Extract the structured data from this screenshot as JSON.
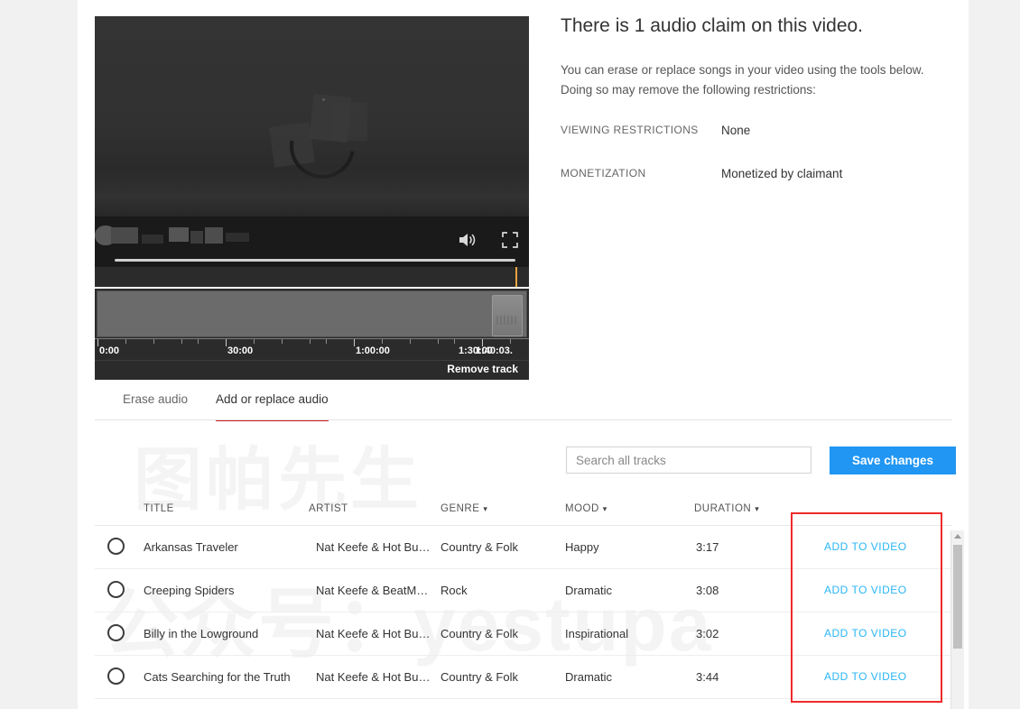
{
  "player": {
    "volume_icon": "volume-icon",
    "fullscreen_icon": "fullscreen-icon",
    "remove_track_label": "Remove track",
    "ruler_labels": [
      "0:00",
      "30:00",
      "1:00:00",
      "1:30:00",
      "1:40:03."
    ]
  },
  "info": {
    "title": "There is 1 audio claim on this video.",
    "description": "You can erase or replace songs in your video using the tools below. Doing so may remove the following restrictions:",
    "fields": [
      {
        "key": "VIEWING RESTRICTIONS",
        "value": "None"
      },
      {
        "key": "MONETIZATION",
        "value": "Monetized by claimant"
      }
    ]
  },
  "tabs": [
    {
      "label": "Erase audio",
      "active": false
    },
    {
      "label": "Add or replace audio",
      "active": true
    }
  ],
  "toolbar": {
    "search_placeholder": "Search all tracks",
    "search_value": "",
    "save_label": "Save changes",
    "save_color": "#2196f3"
  },
  "table": {
    "headers": [
      {
        "label": "TITLE",
        "sortable": false
      },
      {
        "label": "ARTIST",
        "sortable": false
      },
      {
        "label": "GENRE",
        "sortable": true
      },
      {
        "label": "MOOD",
        "sortable": true
      },
      {
        "label": "DURATION",
        "sortable": true
      }
    ],
    "caret": "▾",
    "add_label": "ADD TO VIDEO",
    "add_color": "#29b6f6",
    "rows": [
      {
        "title": "Arkansas Traveler",
        "artist": "Nat Keefe & Hot Bu…",
        "genre": "Country & Folk",
        "mood": "Happy",
        "duration": "3:17"
      },
      {
        "title": "Creeping Spiders",
        "artist": "Nat Keefe & BeatM…",
        "genre": "Rock",
        "mood": "Dramatic",
        "duration": "3:08"
      },
      {
        "title": "Billy in the Lowground",
        "artist": "Nat Keefe & Hot Bu…",
        "genre": "Country & Folk",
        "mood": "Inspirational",
        "duration": "3:02"
      },
      {
        "title": "Cats Searching for the Truth",
        "artist": "Nat Keefe & Hot Bu…",
        "genre": "Country & Folk",
        "mood": "Dramatic",
        "duration": "3:44"
      }
    ]
  },
  "annotation": {
    "color": "#ef2a2a"
  },
  "watermark": {
    "top": "图帕先生",
    "bottom": "公众号：yestupa"
  }
}
